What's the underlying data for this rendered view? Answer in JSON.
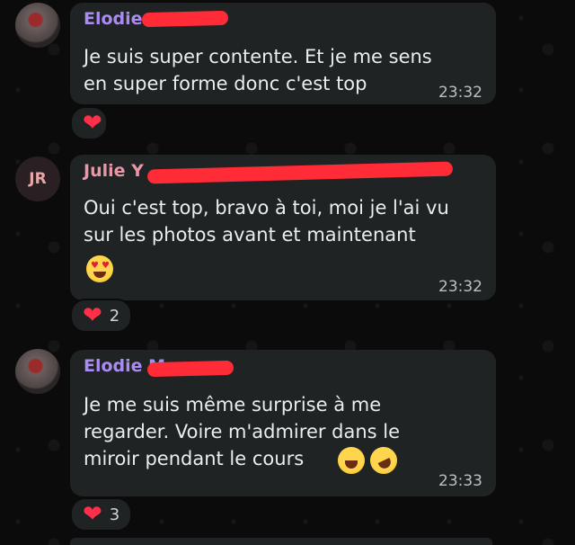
{
  "messages": [
    {
      "sender": "Elodie",
      "sender_color": "#a98bf2",
      "text": "Je suis super contente. Et je me sens\nen super forme donc c'est top",
      "time": "23:32",
      "reaction_count": ""
    },
    {
      "sender": "Julie Y",
      "sender_color": "#e996a6",
      "avatar_initials": "JR",
      "text": "Oui c'est top, bravo à toi, moi je l'ai vu\nsur les photos avant et maintenant",
      "time": "23:32",
      "reaction_count": "2"
    },
    {
      "sender": "Elodie M",
      "sender_color": "#a98bf2",
      "text": "Je me suis même surprise à me\nregarder. Voire m'admirer dans le\nmiroir pendant le cours",
      "time": "23:33",
      "reaction_count": "3"
    }
  ],
  "icons": {
    "reaction": "heart-icon",
    "emoji_1": "heart-eyes-emoji",
    "emoji_2": "grin-sweat-emoji",
    "emoji_3": "rolling-laughing-emoji"
  }
}
